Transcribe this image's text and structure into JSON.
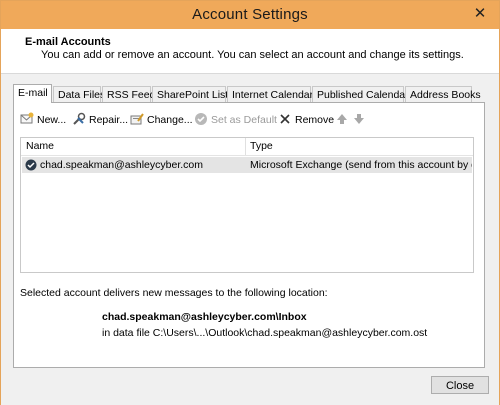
{
  "window": {
    "title": "Account Settings",
    "close_glyph": "✕"
  },
  "header": {
    "title": "E-mail Accounts",
    "description": "You can add or remove an account. You can select an account and change its settings."
  },
  "tabs": [
    {
      "label": "E-mail",
      "active": true
    },
    {
      "label": "Data Files"
    },
    {
      "label": "RSS Feeds"
    },
    {
      "label": "SharePoint Lists"
    },
    {
      "label": "Internet Calendars"
    },
    {
      "label": "Published Calendars"
    },
    {
      "label": "Address Books"
    }
  ],
  "toolbar": {
    "new_label": "New...",
    "repair_label": "Repair...",
    "change_label": "Change...",
    "set_default_label": "Set as Default",
    "remove_label": "Remove"
  },
  "list": {
    "columns": [
      "Name",
      "Type"
    ],
    "rows": [
      {
        "name": "chad.speakman@ashleycyber.com",
        "type": "Microsoft Exchange (send from this account by def..."
      }
    ]
  },
  "info": {
    "delivery_text": "Selected account delivers new messages to the following location:",
    "folder": "chad.speakman@ashleycyber.com\\Inbox",
    "data_file": "in data file C:\\Users\\...\\Outlook\\chad.speakman@ashleycyber.com.ost"
  },
  "footer": {
    "close_label": "Close"
  },
  "colors": {
    "titlebar": "#f0a95a",
    "accent_border": "#e5a45a",
    "selected_row": "#e4e4e4"
  }
}
